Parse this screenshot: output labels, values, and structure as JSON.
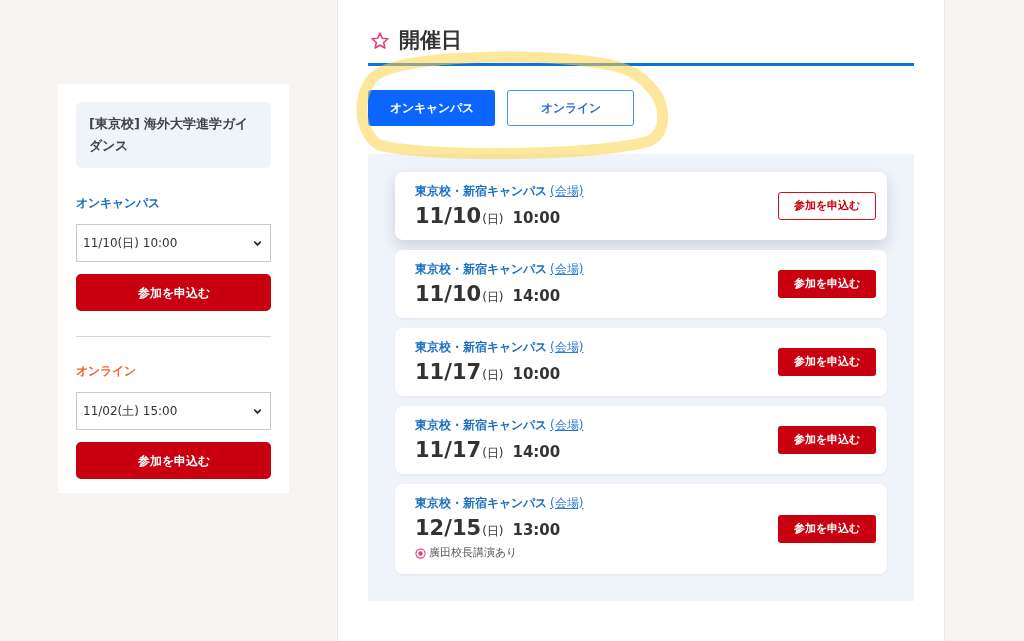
{
  "sidebar": {
    "title": "[東京校] 海外大学進学ガイダンス",
    "sections": [
      {
        "kind": "on_campus",
        "heading": "オンキャンパス",
        "select_value": "11/10(日) 10:00",
        "button": "参加を申込む"
      },
      {
        "kind": "online",
        "heading": "オンライン",
        "select_value": "11/02(土) 15:00",
        "button": "参加を申込む"
      }
    ]
  },
  "main": {
    "heading": "開催日",
    "tabs": [
      {
        "label": "オンキャンパス",
        "selected": true
      },
      {
        "label": "オンライン",
        "selected": false
      }
    ],
    "sessions": [
      {
        "campus": "東京校・新宿キャンパス",
        "venue_link": "(会場)",
        "date": "11/10",
        "weekday": "(日)",
        "time": "10:00",
        "button": "参加を申込む",
        "selected": true
      },
      {
        "campus": "東京校・新宿キャンパス",
        "venue_link": "(会場)",
        "date": "11/10",
        "weekday": "(日)",
        "time": "14:00",
        "button": "参加を申込む",
        "selected": false
      },
      {
        "campus": "東京校・新宿キャンパス",
        "venue_link": "(会場)",
        "date": "11/17",
        "weekday": "(日)",
        "time": "10:00",
        "button": "参加を申込む",
        "selected": false
      },
      {
        "campus": "東京校・新宿キャンパス",
        "venue_link": "(会場)",
        "date": "11/17",
        "weekday": "(日)",
        "time": "14:00",
        "button": "参加を申込む",
        "selected": false
      },
      {
        "campus": "東京校・新宿キャンパス",
        "venue_link": "(会場)",
        "date": "12/15",
        "weekday": "(日)",
        "time": "13:00",
        "button": "参加を申込む",
        "selected": false,
        "note": "廣田校長講演あり"
      }
    ]
  }
}
